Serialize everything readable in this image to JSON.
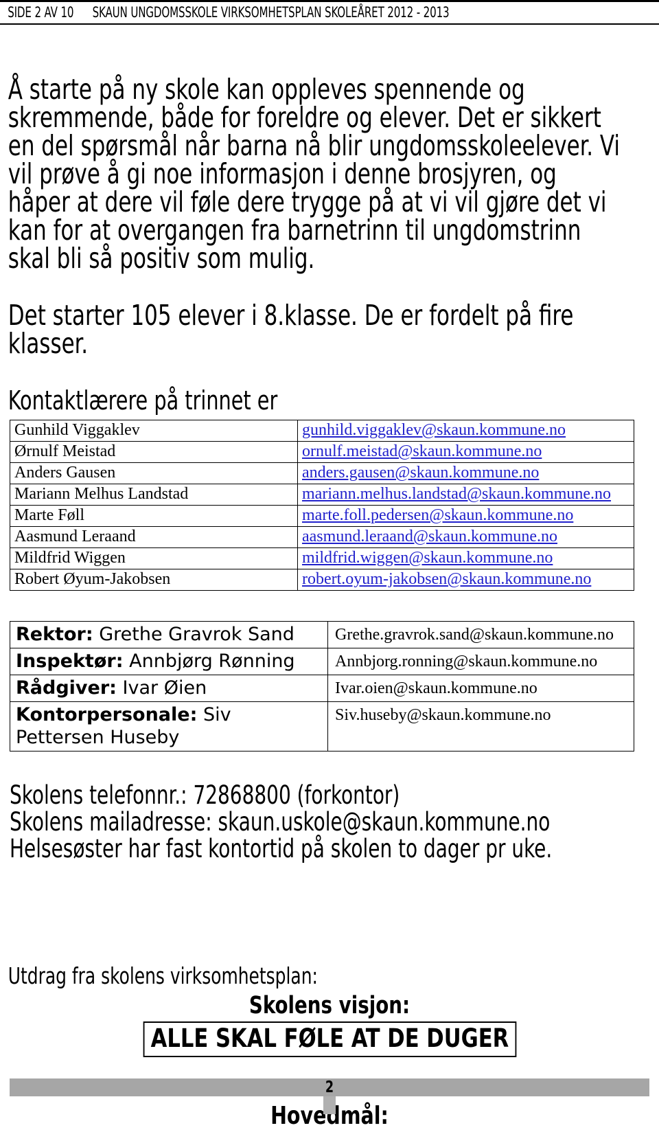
{
  "header": {
    "page_label": "SIDE 2 AV 10",
    "document_title": "SKAUN UNGDOMSSKOLE VIRKSOMHETSPLAN SKOLEÅRET 2012 - 2013"
  },
  "body": {
    "intro_paragraph": "Å starte på ny skole kan oppleves spennende og skremmende, både for foreldre og elever. Det er sikkert en del spørsmål når barna nå blir ungdomsskoleelever. Vi vil prøve å gi noe informasjon i denne brosjyren, og håper at dere vil føle dere trygge på at vi vil gjøre det vi kan for at overgangen fra barnetrinn til ungdomstrinn skal bli så positiv som mulig.",
    "student_count_paragraph": "Det starter 105 elever i 8.klasse. De er fordelt på fire klasser.",
    "contact_teachers_heading": "Kontaktlærere på trinnet er"
  },
  "teachers_table": {
    "rows": [
      {
        "name": "Gunhild Viggaklev",
        "email": "gunhild.viggaklev@skaun.kommune.no"
      },
      {
        "name": "Ørnulf Meistad",
        "email": "ornulf.meistad@skaun.kommune.no"
      },
      {
        "name": "Anders Gausen",
        "email": "anders.gausen@skaun.kommune.no"
      },
      {
        "name": "Mariann Melhus Landstad",
        "email": "mariann.melhus.landstad@skaun.kommune.no"
      },
      {
        "name": "Marte Føll",
        "email": "marte.foll.pedersen@skaun.kommune.no"
      },
      {
        "name": "Aasmund Leraand",
        "email": "aasmund.leraand@skaun.kommune.no"
      },
      {
        "name": "Mildfrid Wiggen",
        "email": "mildfrid.wiggen@skaun.kommune.no"
      },
      {
        "name": "Robert Øyum-Jakobsen",
        "email": "robert.oyum-jakobsen@skaun.kommune.no"
      }
    ]
  },
  "staff_table": {
    "rows": [
      {
        "role": "Rektor:",
        "person": "Grethe Gravrok Sand",
        "email": "Grethe.gravrok.sand@skaun.kommune.no"
      },
      {
        "role": "Inspektør:",
        "person": "Annbjørg Rønning",
        "email": "Annbjorg.ronning@skaun.kommune.no"
      },
      {
        "role": "Rådgiver:",
        "person": "Ivar Øien",
        "email": "Ivar.oien@skaun.kommune.no"
      },
      {
        "role": "Kontorpersonale:",
        "person": "Siv Pettersen Huseby",
        "email": "Siv.huseby@skaun.kommune.no"
      }
    ]
  },
  "contact_info": {
    "phone_line": "Skolens telefonnr.: 72868800 (forkontor)",
    "mail_line": "Skolens mailadresse: skaun.uskole@skaun.kommune.no",
    "nurse_line": "Helsesøster har fast kontortid på skolen to dager pr uke."
  },
  "vision_section": {
    "excerpt_label": "Utdrag fra skolens virksomhetsplan:",
    "vision_heading": "Skolens visjon:",
    "vision_statement": "ALLE SKAL FØLE AT DE DUGER",
    "goal_heading": "Hovedmål:"
  },
  "footer": {
    "page_number": "2"
  },
  "colors": {
    "link": "#2222cc",
    "footer_bar": "#a6a6a6",
    "text": "#000000"
  }
}
